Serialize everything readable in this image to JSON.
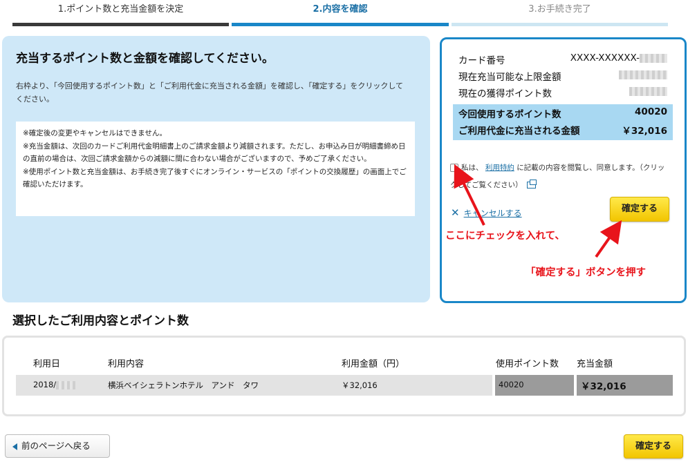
{
  "steps": [
    {
      "label": "1.ポイント数と充当金額を決定"
    },
    {
      "label": "2.内容を確認"
    },
    {
      "label": "3.お手続き完了"
    }
  ],
  "left": {
    "title": "充当するポイント数と金額を確認してください。",
    "description": "右枠より、「今回使用するポイント数」と「ご利用代金に充当される金額」を確認し、「確定する」をクリックしてください。",
    "notices": [
      "※確定後の変更やキャンセルはできません。",
      "※充当金額は、次回のカードご利用代金明細書上のご請求金額より減額されます。ただし、お申込み日が明細書締め日の直前の場合は、次回ご請求金額からの減額に間に合わない場合がございますので、予めご了承ください。",
      "※使用ポイント数と充当金額は、お手続き完了後すぐにオンライン・サービスの「ポイントの交換履歴」の画面上でご確認いただけます。"
    ]
  },
  "right": {
    "card_label": "カード番号",
    "card_value": "XXXX-XXXXXX-",
    "limit_label": "現在充当可能な上限金額",
    "points_label": "現在の獲得ポイント数",
    "use_points_label": "今回使用するポイント数",
    "use_points_value": "40020",
    "charge_label": "ご利用代金に充当される金額",
    "charge_value": "￥32,016",
    "agree_prefix": "私は、",
    "agree_link": "利用特約",
    "agree_suffix": "に記載の内容を閲覧し、同意します。（クリックしてご覧ください）",
    "cancel_label": "キャンセルする",
    "confirm_label": "確定する"
  },
  "annotations": {
    "check": "ここにチェックを入れて、",
    "press": "「確定する」ボタンを押す"
  },
  "section": {
    "title": "選択したご利用内容とポイント数",
    "headers": {
      "date": "利用日",
      "content": "利用内容",
      "amount": "利用金額（円）",
      "points": "使用ポイント数",
      "applied": "充当金額"
    },
    "row": {
      "date": "2018/",
      "content": "横浜ベイシェラトンホテル　アンド　タワ",
      "amount": "￥32,016",
      "points": "40020",
      "applied": "￥32,016"
    }
  },
  "footer": {
    "back_label": "前のページへ戻る",
    "confirm_label": "確定する"
  },
  "colors": {
    "accent_blue": "#1a87c8",
    "light_blue_panel": "#cfe8f8",
    "highlight_blue": "#a8d8f2",
    "button_yellow": "#f2c500",
    "annotation_red": "#e8141b"
  }
}
